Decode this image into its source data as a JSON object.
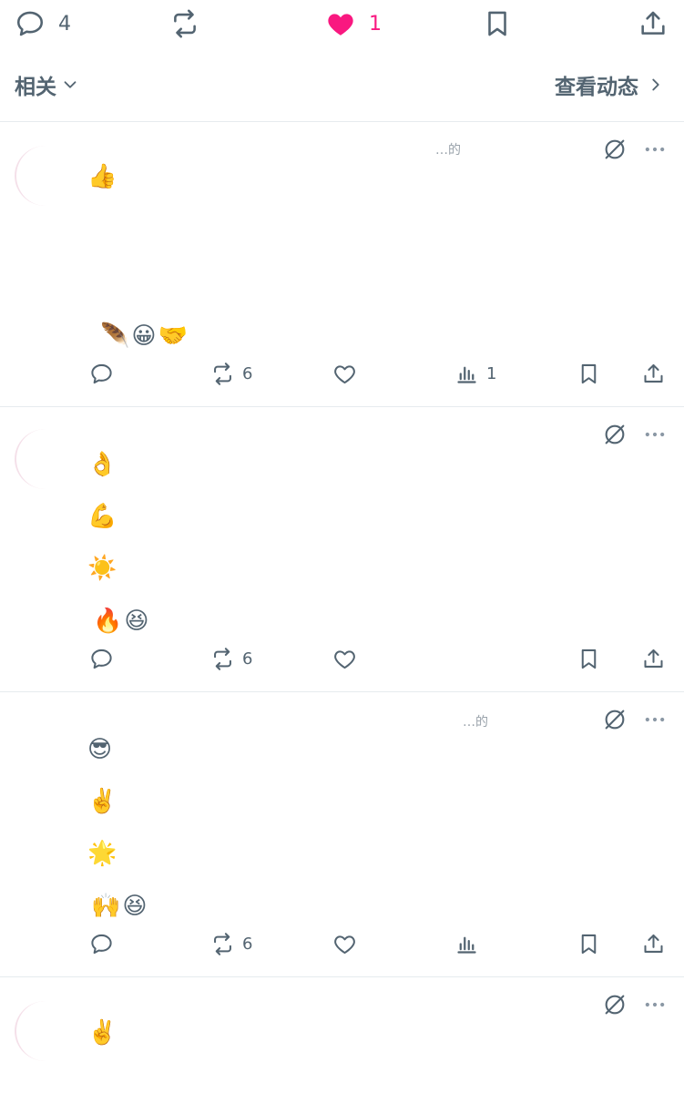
{
  "top_actions": {
    "reply_count": "4",
    "like_count": "1",
    "like_color": "#f91880"
  },
  "related": {
    "label": "相关",
    "view_activity": "查看动态"
  },
  "posts": [
    {
      "emoji_lines": [
        "👍",
        "🪶😀🤝"
      ],
      "faint_header": "…的",
      "retweets": "6",
      "views": "1"
    },
    {
      "emoji_lines": [
        "👌",
        "💪",
        "☀️",
        "🔥😆"
      ],
      "retweets": "6"
    },
    {
      "emoji_lines": [
        "😎",
        "✌️",
        "🌟",
        "🙌😆"
      ],
      "faint_header": "…的",
      "retweets": "6"
    },
    {
      "emoji_lines": [
        "✌️"
      ]
    }
  ],
  "icons": {
    "reply": "reply-icon",
    "retweet": "retweet-icon",
    "like": "heart-icon",
    "views": "views-icon",
    "bookmark": "bookmark-icon",
    "share": "share-icon",
    "grok": "grok-icon",
    "more": "more-icon"
  }
}
